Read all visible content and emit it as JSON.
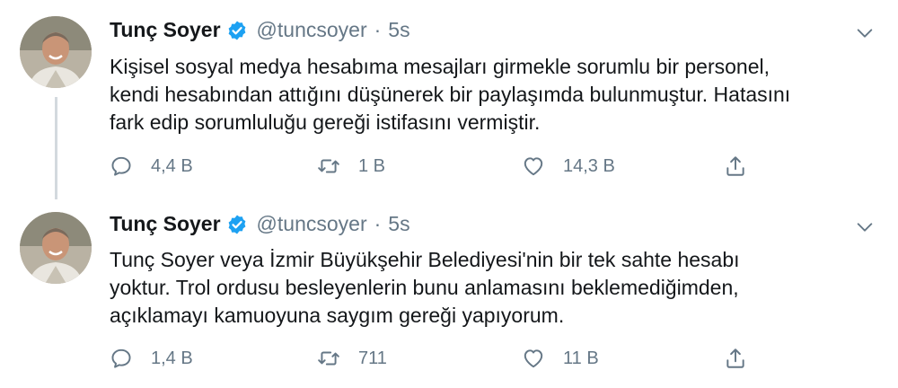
{
  "tweets": [
    {
      "author": {
        "name": "Tunç Soyer",
        "handle": "@tuncsoyer",
        "separator": "·",
        "time": "5s",
        "verified": true
      },
      "text": "Kişisel sosyal medya hesabıma mesajları girmekle sorumlu bir personel,\nkendi hesabından attığını düşünerek bir paylaşımda bulunmuştur. Hatasını\nfark edip sorumluluğu gereği istifasını vermiştir.",
      "actions": {
        "replies": "4,4 B",
        "retweets": "1 B",
        "likes": "14,3 B"
      }
    },
    {
      "author": {
        "name": "Tunç Soyer",
        "handle": "@tuncsoyer",
        "separator": "·",
        "time": "5s",
        "verified": true
      },
      "text": "Tunç Soyer veya İzmir Büyükşehir Belediyesi'nin bir tek sahte hesabı\nyoktur.  Trol ordusu besleyenlerin bunu anlamasını beklemediğimden,\naçıklamayı kamuoyuna saygım gereği yapıyorum.",
      "actions": {
        "replies": "1,4 B",
        "retweets": "711",
        "likes": "11 B"
      }
    }
  ],
  "colors": {
    "text": "#14171a",
    "secondary": "#657786",
    "verified": "#1da1f2",
    "thread_line": "#d3d9de"
  },
  "icons": [
    "verified-badge-icon",
    "chevron-down-icon",
    "reply-icon",
    "retweet-icon",
    "like-icon",
    "share-icon"
  ]
}
